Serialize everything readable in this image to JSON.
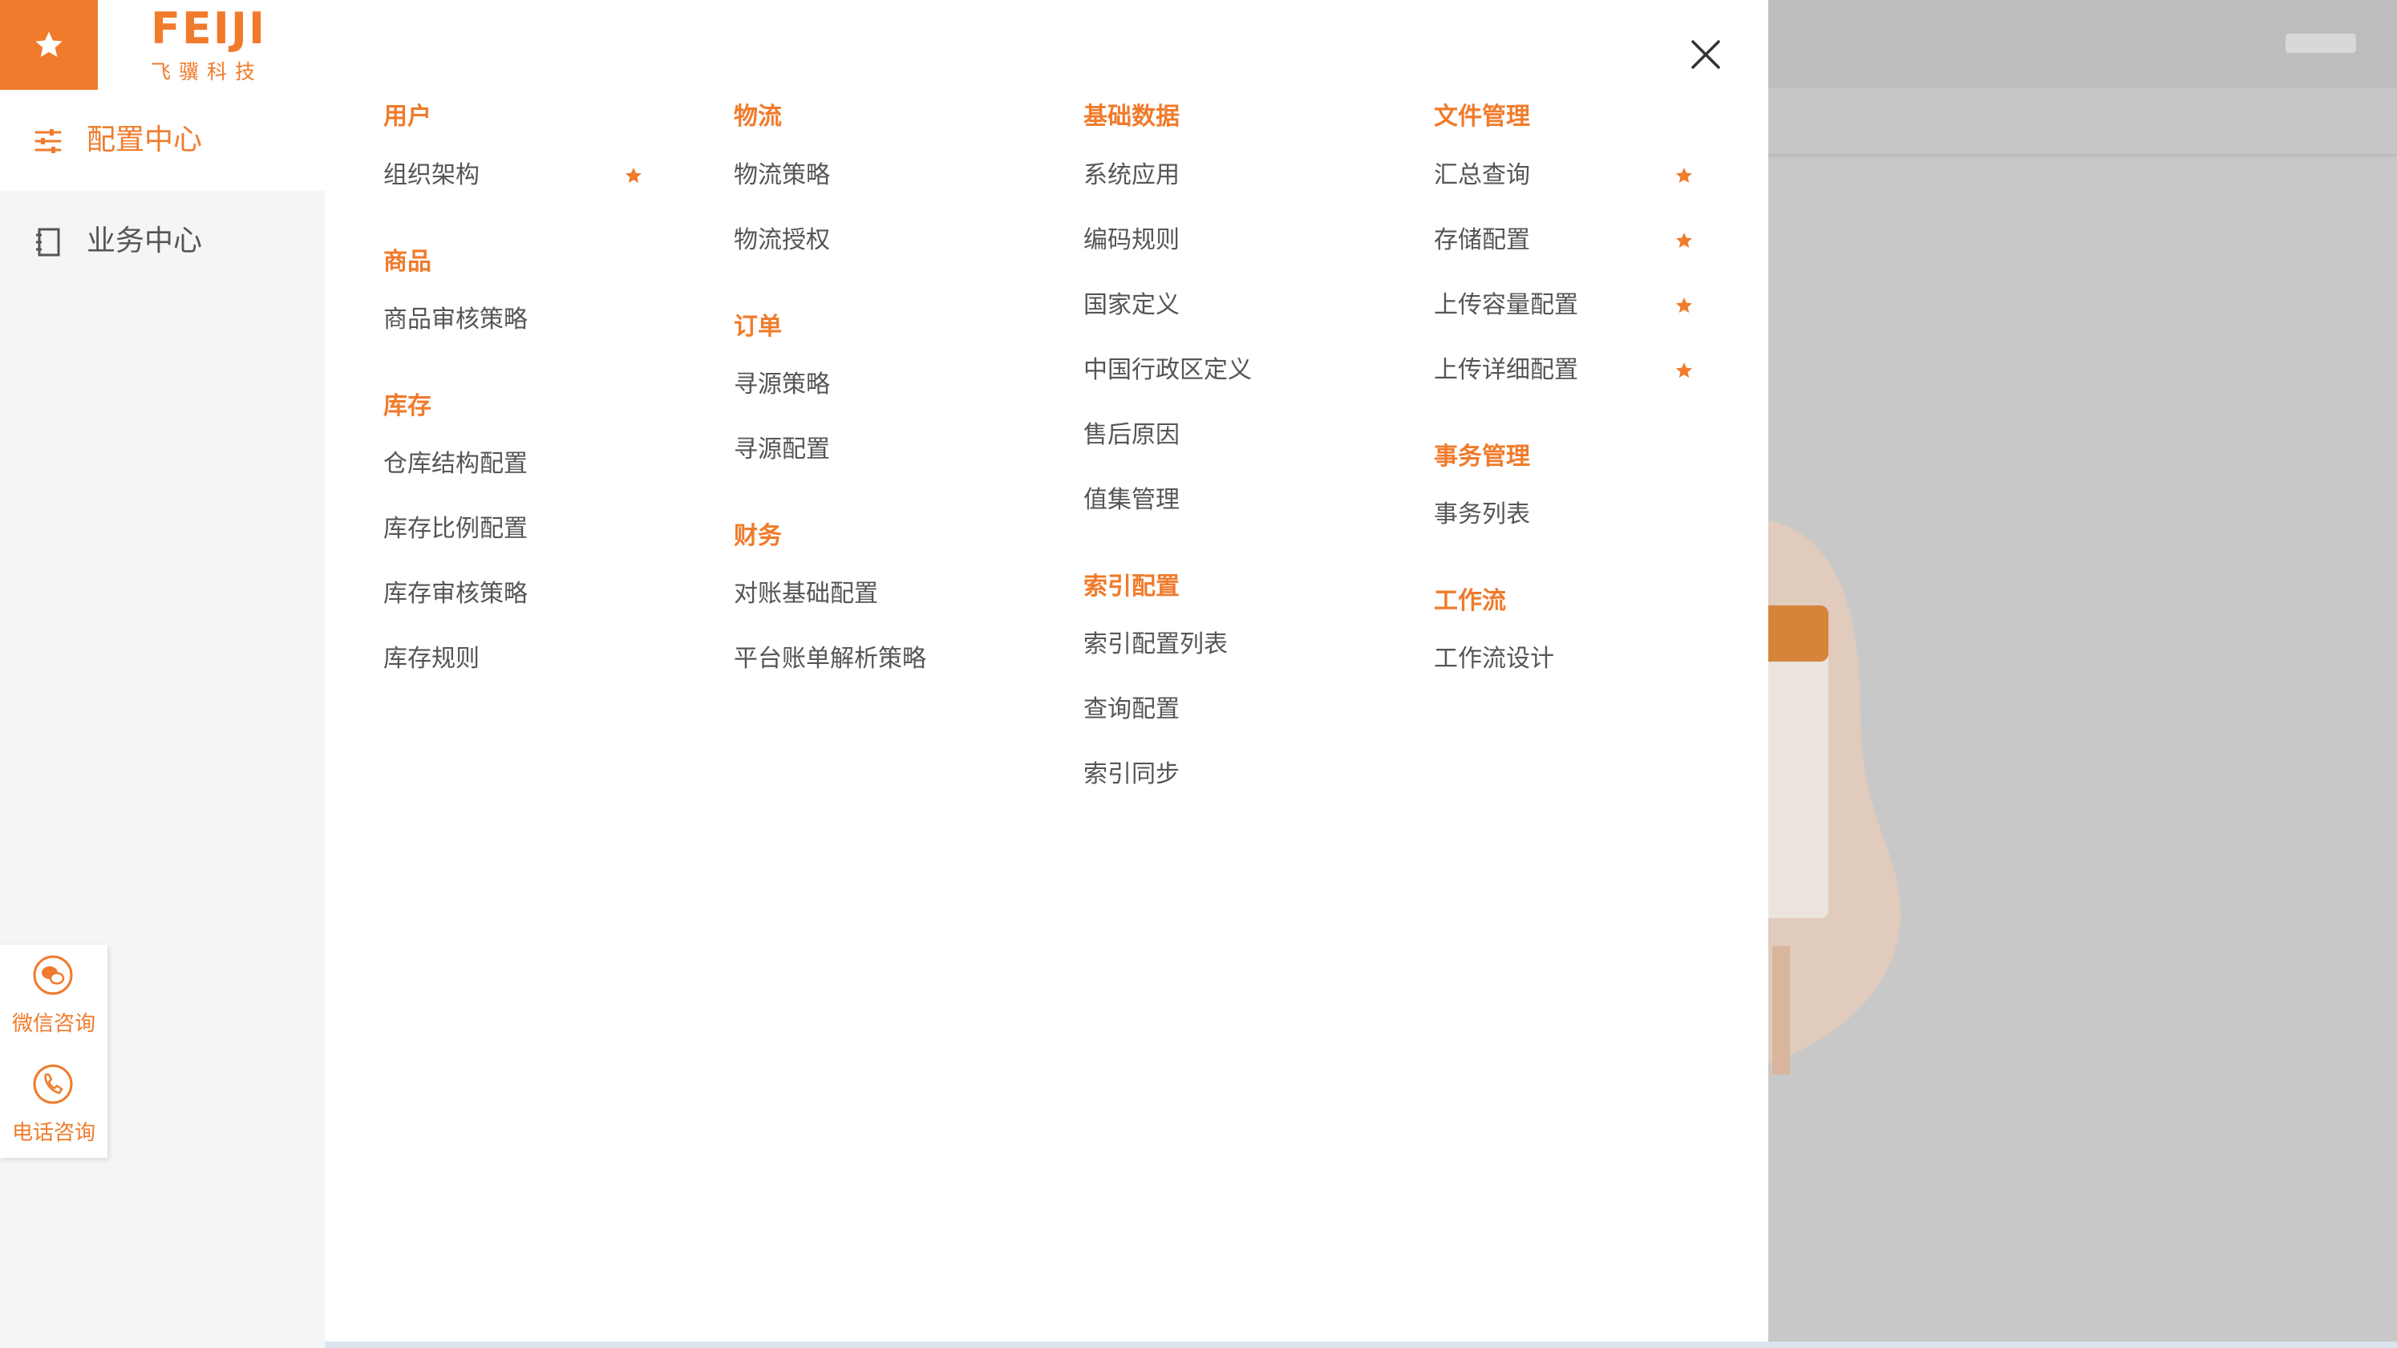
{
  "brand": {
    "logo_text": "FEIJI",
    "logo_sub": "飞骥科技",
    "accent_color": "#f07b2c"
  },
  "sidebar": {
    "items": [
      {
        "label": "配置中心",
        "icon": "sliders-icon",
        "active": true
      },
      {
        "label": "业务中心",
        "icon": "notebook-icon",
        "active": false
      }
    ]
  },
  "contact": {
    "wechat_label": "微信咨询",
    "phone_label": "电话咨询"
  },
  "menu": {
    "columns": [
      {
        "sections": [
          {
            "title": "用户",
            "items": [
              {
                "label": "组织架构",
                "starred": true
              }
            ]
          },
          {
            "title": "商品",
            "items": [
              {
                "label": "商品审核策略",
                "starred": false
              }
            ]
          },
          {
            "title": "库存",
            "items": [
              {
                "label": "仓库结构配置",
                "starred": false
              },
              {
                "label": "库存比例配置",
                "starred": false
              },
              {
                "label": "库存审核策略",
                "starred": false
              },
              {
                "label": "库存规则",
                "starred": false
              }
            ]
          }
        ]
      },
      {
        "sections": [
          {
            "title": "物流",
            "items": [
              {
                "label": "物流策略",
                "starred": false
              },
              {
                "label": "物流授权",
                "starred": false
              }
            ]
          },
          {
            "title": "订单",
            "items": [
              {
                "label": "寻源策略",
                "starred": false
              },
              {
                "label": "寻源配置",
                "starred": false
              }
            ]
          },
          {
            "title": "财务",
            "items": [
              {
                "label": "对账基础配置",
                "starred": false
              },
              {
                "label": "平台账单解析策略",
                "starred": false
              }
            ]
          }
        ]
      },
      {
        "sections": [
          {
            "title": "基础数据",
            "items": [
              {
                "label": "系统应用",
                "starred": false
              },
              {
                "label": "编码规则",
                "starred": false
              },
              {
                "label": "国家定义",
                "starred": false
              },
              {
                "label": "中国行政区定义",
                "starred": false
              },
              {
                "label": "售后原因",
                "starred": false
              },
              {
                "label": "值集管理",
                "starred": false
              }
            ]
          },
          {
            "title": "索引配置",
            "items": [
              {
                "label": "索引配置列表",
                "starred": false
              },
              {
                "label": "查询配置",
                "starred": false
              },
              {
                "label": "索引同步",
                "starred": false
              }
            ]
          }
        ]
      },
      {
        "sections": [
          {
            "title": "文件管理",
            "items": [
              {
                "label": "汇总查询",
                "starred": true
              },
              {
                "label": "存储配置",
                "starred": true
              },
              {
                "label": "上传容量配置",
                "starred": true
              },
              {
                "label": "上传详细配置",
                "starred": true
              }
            ]
          },
          {
            "title": "事务管理",
            "items": [
              {
                "label": "事务列表",
                "starred": false
              }
            ]
          },
          {
            "title": "工作流",
            "items": [
              {
                "label": "工作流设计",
                "starred": false
              }
            ]
          }
        ]
      }
    ]
  }
}
